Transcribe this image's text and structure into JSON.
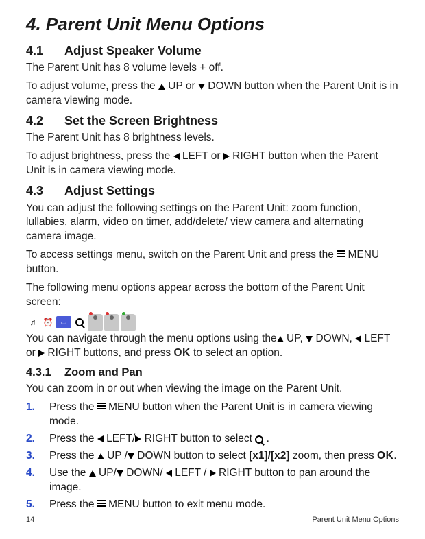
{
  "title": "4. Parent Unit Menu Options",
  "s41": {
    "num": "4.1",
    "title": "Adjust Speaker Volume",
    "p1": "The Parent Unit has 8 volume levels + off.",
    "p2a": "To adjust volume, press the ",
    "p2b": " UP or ",
    "p2c": " DOWN button when the Parent Unit is in camera viewing mode."
  },
  "s42": {
    "num": "4.2",
    "title": "Set the Screen Brightness",
    "p1": "The Parent Unit has 8 brightness levels.",
    "p2a": "To adjust brightness, press the ",
    "p2b": " LEFT or ",
    "p2c": " RIGHT button when the Parent Unit is in camera viewing mode."
  },
  "s43": {
    "num": "4.3",
    "title": "Adjust Settings",
    "p1": "You can adjust the following settings on the Parent Unit: zoom function, lullabies, alarm, video on timer, add/delete/ view camera and alternating camera image.",
    "p2a": "To access settings menu, switch on the Parent Unit and press the ",
    "p2b": " MENU button.",
    "p3": "The following menu options appear across the bottom of the Parent Unit screen:",
    "p4a": "You can navigate through the menu options using the",
    "p4b": " UP, ",
    "p4c": " DOWN, ",
    "p4d": " LEFT or ",
    "p4e": " RIGHT buttons, and press ",
    "p4f": " to select an option.",
    "ok": "OK"
  },
  "s431": {
    "num": "4.3.1",
    "title": "Zoom and Pan",
    "p1": "You can zoom in or out when viewing the image on the Parent Unit.",
    "steps": [
      {
        "n": "1.",
        "a": "Press the ",
        "b": " MENU button when the Parent Unit is in camera viewing mode."
      },
      {
        "n": "2.",
        "a": "Press the ",
        "b": " LEFT/",
        "c": " RIGHT button to select  ",
        "d": " ."
      },
      {
        "n": "3.",
        "a": "Press the ",
        "b": " UP /",
        "c": " DOWN button to select ",
        "d": "[x1]/[x2]",
        "e": " zoom, then press ",
        "f": "."
      },
      {
        "n": "4.",
        "a": "Use the ",
        "b": " UP/",
        "c": " DOWN/ ",
        "d": " LEFT / ",
        "e": " RIGHT button to pan around the image."
      },
      {
        "n": "5.",
        "a": "Press the ",
        "b": " MENU button to exit menu mode."
      }
    ],
    "ok": "OK"
  },
  "footer": {
    "page": "14",
    "section": "Parent Unit Menu Options"
  }
}
